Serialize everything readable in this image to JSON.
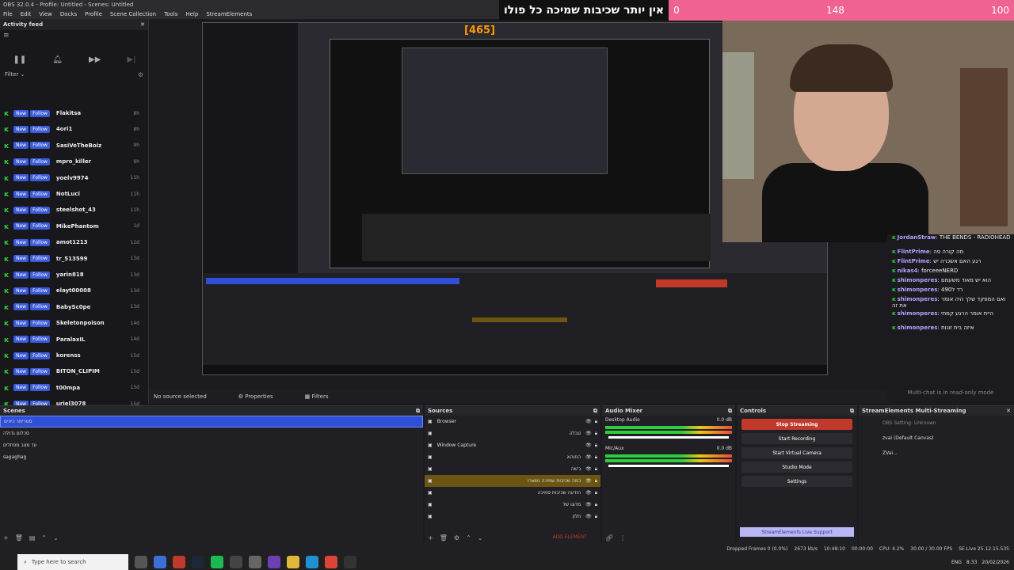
{
  "window": {
    "title": "OBS 32.0.4 - Profile: Untitled - Scenes: Untitled"
  },
  "menu": [
    "File",
    "Edit",
    "View",
    "Docks",
    "Profile",
    "Scene Collection",
    "Tools",
    "Help",
    "StreamElements"
  ],
  "activity": {
    "title": "Activity feed",
    "filter_label": "Filter",
    "items": [
      {
        "badge_new": "New",
        "badge_follow": "Follow",
        "name": "Flakitsa",
        "age": "8h"
      },
      {
        "badge_new": "New",
        "badge_follow": "Follow",
        "name": "4ori1",
        "age": "8h"
      },
      {
        "badge_new": "New",
        "badge_follow": "Follow",
        "name": "SasiVeTheBoiz",
        "age": "9h"
      },
      {
        "badge_new": "New",
        "badge_follow": "Follow",
        "name": "mpro_killer",
        "age": "9h"
      },
      {
        "badge_new": "New",
        "badge_follow": "Follow",
        "name": "yoelv9974",
        "age": "11h"
      },
      {
        "badge_new": "New",
        "badge_follow": "Follow",
        "name": "NotLuci",
        "age": "11h"
      },
      {
        "badge_new": "New",
        "badge_follow": "Follow",
        "name": "steelshot_43",
        "age": "11h"
      },
      {
        "badge_new": "New",
        "badge_follow": "Follow",
        "name": "MikePhantom",
        "age": "1d"
      },
      {
        "badge_new": "New",
        "badge_follow": "Follow",
        "name": "amot1213",
        "age": "12d"
      },
      {
        "badge_new": "New",
        "badge_follow": "Follow",
        "name": "tr_513599",
        "age": "13d"
      },
      {
        "badge_new": "New",
        "badge_follow": "Follow",
        "name": "yarin818",
        "age": "13d"
      },
      {
        "badge_new": "New",
        "badge_follow": "Follow",
        "name": "elayt00008",
        "age": "13d"
      },
      {
        "badge_new": "New",
        "badge_follow": "Follow",
        "name": "BabySc0pe",
        "age": "13d"
      },
      {
        "badge_new": "New",
        "badge_follow": "Follow",
        "name": "Skeletonpoison",
        "age": "14d"
      },
      {
        "badge_new": "New",
        "badge_follow": "Follow",
        "name": "ParalaxIL",
        "age": "14d"
      },
      {
        "badge_new": "New",
        "badge_follow": "Follow",
        "name": "korenss",
        "age": "15d"
      },
      {
        "badge_new": "New",
        "badge_follow": "Follow",
        "name": "BITON_CLIPIM",
        "age": "15d"
      },
      {
        "badge_new": "New",
        "badge_follow": "Follow",
        "name": "t00mpa",
        "age": "15d"
      },
      {
        "badge_new": "New",
        "badge_follow": "Follow",
        "name": "uriel3078",
        "age": "15d"
      }
    ]
  },
  "overlay": {
    "text": "אין יותר שכיבות שמיכה כל פולו",
    "min": "0",
    "current": "148",
    "max": "100",
    "nested_counter": "[465]"
  },
  "chat": {
    "lines": [
      {
        "user": "JordanStraw",
        "msg": "THE BENDS - RADIOHEAD"
      },
      {
        "user": "FlintPrime",
        "msg": "מה קורה פה"
      },
      {
        "user": "FlintPrime",
        "msg": "רגע האם אשכרה יש"
      },
      {
        "user": "nikas4",
        "msg": "forceeeNERD"
      },
      {
        "user": "shimonperes",
        "msg": "הוא יש מאוד משעמם"
      },
      {
        "user": "shimonperes",
        "msg": "רד ל490"
      },
      {
        "user": "shimonperes",
        "msg": "ואם המפקד שלך היה אומר את זה"
      },
      {
        "user": "shimonperes",
        "msg": "היית אומר הרגע קמתי"
      },
      {
        "user": "shimonperes",
        "msg": "איזה בית זונות"
      }
    ],
    "readonly": "Multi-chat is in read-only mode"
  },
  "midstrip": {
    "source": "No source selected",
    "properties": "Properties",
    "filters": "Filters"
  },
  "scenes": {
    "title": "Scenes",
    "items": [
      "סטרימר כיפים",
      "סכלום גדולה",
      "עד מצב מפחלים",
      "sagaghag"
    ]
  },
  "sources": {
    "title": "Sources",
    "items": [
      "Browser",
      "טבלה",
      "Window Capture",
      "החוהא",
      "ג'שה",
      "כמה שכיבות שמיכה נשארו",
      "הודעה שכיבות סמיכה",
      "מדוגו של",
      "חלון"
    ],
    "add_element": "ADD ELEMENT"
  },
  "mixer": {
    "title": "Audio Mixer",
    "channels": [
      {
        "name": "Desktop Audio",
        "db": "0.0 dB"
      },
      {
        "name": "Mic/Aux",
        "db": "0.0 dB"
      }
    ]
  },
  "controls": {
    "title": "Controls",
    "buttons": [
      "Stop Streaming",
      "Start Recording",
      "Start Virtual Camera",
      "Studio Mode",
      "Settings"
    ],
    "live_support": "StreamElements Live Support"
  },
  "multistream": {
    "title": "StreamElements Multi-Streaming",
    "status": "OBS Setting: Unknown",
    "rows": [
      "zvai (Default Canvas)",
      "ZVai..."
    ]
  },
  "status": {
    "dropped": "Dropped Frames 0 (0.0%)",
    "bitrate": "2673 kb/s",
    "time": "10:48:10",
    "rec": "00:00:00",
    "cpu": "CPU: 4.2%",
    "fps": "30.00 / 30.00 FPS",
    "version": "SE.Live 25.12.15.535"
  },
  "taskbar": {
    "search_placeholder": "Type here to search",
    "clock": "8:33",
    "date": "20/02/2026",
    "lang": "ENG"
  },
  "colors": {
    "accent": "#3b5bdb",
    "stop": "#c0392b",
    "pink": "#f06292"
  }
}
